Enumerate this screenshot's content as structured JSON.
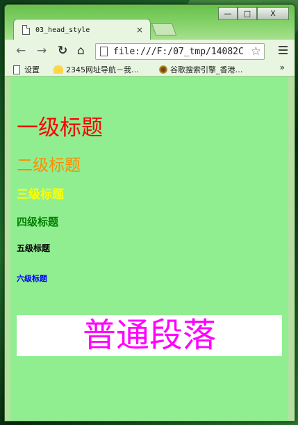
{
  "window": {
    "controls": {
      "minimize": "—",
      "maximize": "□",
      "close": "X"
    }
  },
  "tab": {
    "title": "03_head_style",
    "close": "×"
  },
  "toolbar": {
    "back_icon": "back-arrow-icon",
    "forward_icon": "forward-arrow-icon",
    "reload_icon": "reload-icon",
    "home_icon": "home-icon",
    "address": "file:///F:/07_tmp/14082C",
    "star_icon": "bookmark-star-icon",
    "menu_icon": "hamburger-menu-icon"
  },
  "bookmarks": {
    "items": [
      {
        "label": "设置",
        "icon": "document-icon"
      },
      {
        "label": "2345网址导航－我…",
        "icon": "2345-logo-icon"
      },
      {
        "label": "谷歌搜索引擎_香港…",
        "icon": "google-doodle-icon"
      }
    ],
    "more": "»"
  },
  "page": {
    "background": "#90ee90",
    "headings": {
      "h1": {
        "text": "一级标题",
        "color": "#ff0000"
      },
      "h2": {
        "text": "二级标题",
        "color": "#ff8c00"
      },
      "h3": {
        "text": "三级标题",
        "color": "#ffff00"
      },
      "h4": {
        "text": "四级标题",
        "color": "#008000"
      },
      "h5": {
        "text": "五级标题",
        "color": "#000000"
      },
      "h6": {
        "text": "六级标题",
        "color": "#0000ff"
      }
    },
    "paragraph": {
      "text": "普通段落",
      "color": "#ff00ff",
      "background": "#ffffff"
    }
  }
}
